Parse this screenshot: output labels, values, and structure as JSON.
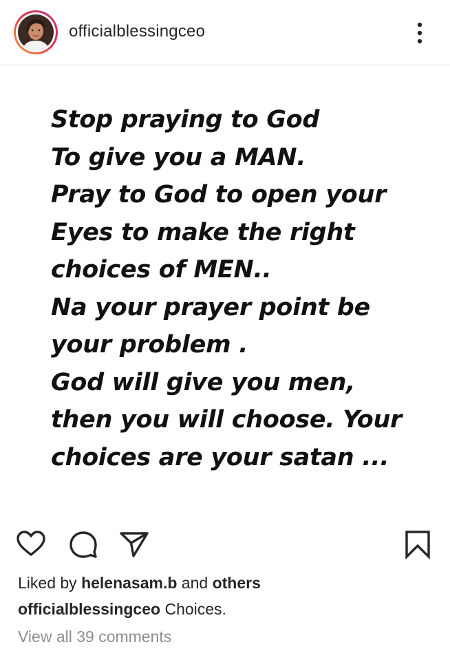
{
  "header": {
    "username": "officialblessingceo",
    "avatar_icon": "profile-photo",
    "more_icon": "more-vertical-icon"
  },
  "post": {
    "text": "Stop praying to God\nTo give you a MAN.\nPray to God to open your\nEyes to make the right\nchoices of MEN..\nNa your prayer point be\nyour problem .\nGod will give you men,\nthen you will choose. Your\nchoices are your satan ..."
  },
  "actions": {
    "like_icon": "heart-icon",
    "comment_icon": "comment-bubble-icon",
    "share_icon": "send-paper-plane-icon",
    "save_icon": "bookmark-icon"
  },
  "likes": {
    "prefix": "Liked by ",
    "user": "helenasam.b",
    "middle": " and ",
    "others": "others"
  },
  "caption": {
    "username": "officialblessingceo",
    "text": " Choices."
  },
  "comments": {
    "view_all": "View all 39 comments"
  },
  "colors": {
    "text": "#262626",
    "muted": "#8e8e8e",
    "divider": "#dbdbdb",
    "story_ring_start": "#f9a03f",
    "story_ring_end": "#c13584"
  }
}
